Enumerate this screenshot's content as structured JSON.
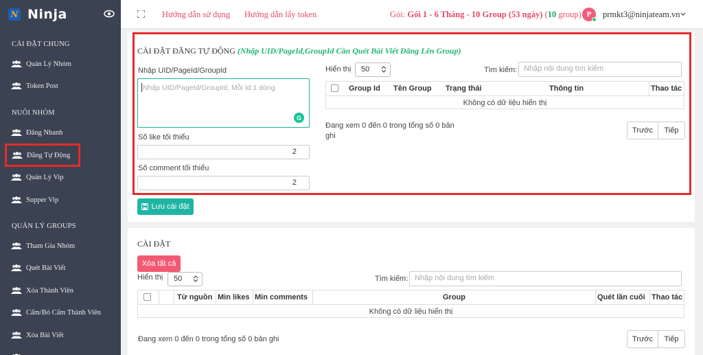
{
  "app": {
    "brand": "Ninja"
  },
  "sidebar": {
    "sections": [
      {
        "title": "CÀI ĐẶT CHUNG",
        "items": [
          "Quản Lý Nhóm",
          "Token Post"
        ]
      },
      {
        "title": "NUÔI NHÓM",
        "items": [
          "Đăng Nhanh",
          "Đăng Tự Động",
          "Quản Lý Vip",
          "Supper Vip"
        ]
      },
      {
        "title": "QUẢN LÝ GROUPS",
        "items": [
          "Tham Gia Nhóm",
          "Quét Bài Viết",
          "Xóa Thành Viên",
          "Cấm/Bỏ Cấm Thành Viên",
          "Xóa Bài Viết"
        ]
      }
    ],
    "active_item": "Đăng Tự Động"
  },
  "topbar": {
    "link_usage": "Hướng dẫn sử dụng",
    "link_token": "Hướng dẫn lấy token",
    "package_prefix": "Gói:",
    "package_name": "Gói 1 - 6 Tháng - 10 Group (53 ngày)",
    "group_count_open": "(",
    "group_count": "10",
    "group_count_close": "group)",
    "avatar_letter": "P",
    "user_email": "prmkt3@ninjateam.vn"
  },
  "auto_post": {
    "title": "CÀI ĐẶT ĐĂNG TỰ ĐỘNG",
    "hint": "(Nhập UID/PageId,GroupId Cần Quét Bài Viết Đăng Lên Group)",
    "uid_label": "Nhập UID/PageId/GroupId",
    "uid_placeholder": "Nhập UID/PageId/GroupId, Mỗi Id 1 dòng",
    "min_like_label": "Số like tối thiểu",
    "min_like_value": "2",
    "min_comment_label": "Số comment tối thiểu",
    "min_comment_value": "2",
    "show_label": "Hiển thị",
    "show_value": "50",
    "search_label": "Tìm kiếm:",
    "search_placeholder": "Nhập nội dung tìm kiếm",
    "columns": [
      "Group Id",
      "Tên Group",
      "Trạng thái",
      "Thông tin",
      "Thao tác"
    ],
    "empty_text": "Không có dữ liệu hiển thị",
    "info_line1": "Đang xem 0 đến 0 trong tổng số 0 bản",
    "info_line2": "ghi",
    "prev": "Trước",
    "next": "Tiếp",
    "save_button": "Lưu cài đặt"
  },
  "settings": {
    "title": "CÀI ĐẶT",
    "delete_all": "Xóa tất cả",
    "show_label": "Hiển thị",
    "show_value": "50",
    "search_label": "Tìm kiếm:",
    "search_placeholder": "Nhập nội dung tìm kiếm",
    "columns": [
      "Từ nguồn",
      "Min likes",
      "Min comments",
      "Group",
      "Quét lần cuối",
      "Thao tác"
    ],
    "empty_text": "Không có dữ liệu hiển thị",
    "info": "Đang xem 0 đến 0 trong tổng số 0 bản ghi",
    "prev": "Trước",
    "next": "Tiếp"
  }
}
